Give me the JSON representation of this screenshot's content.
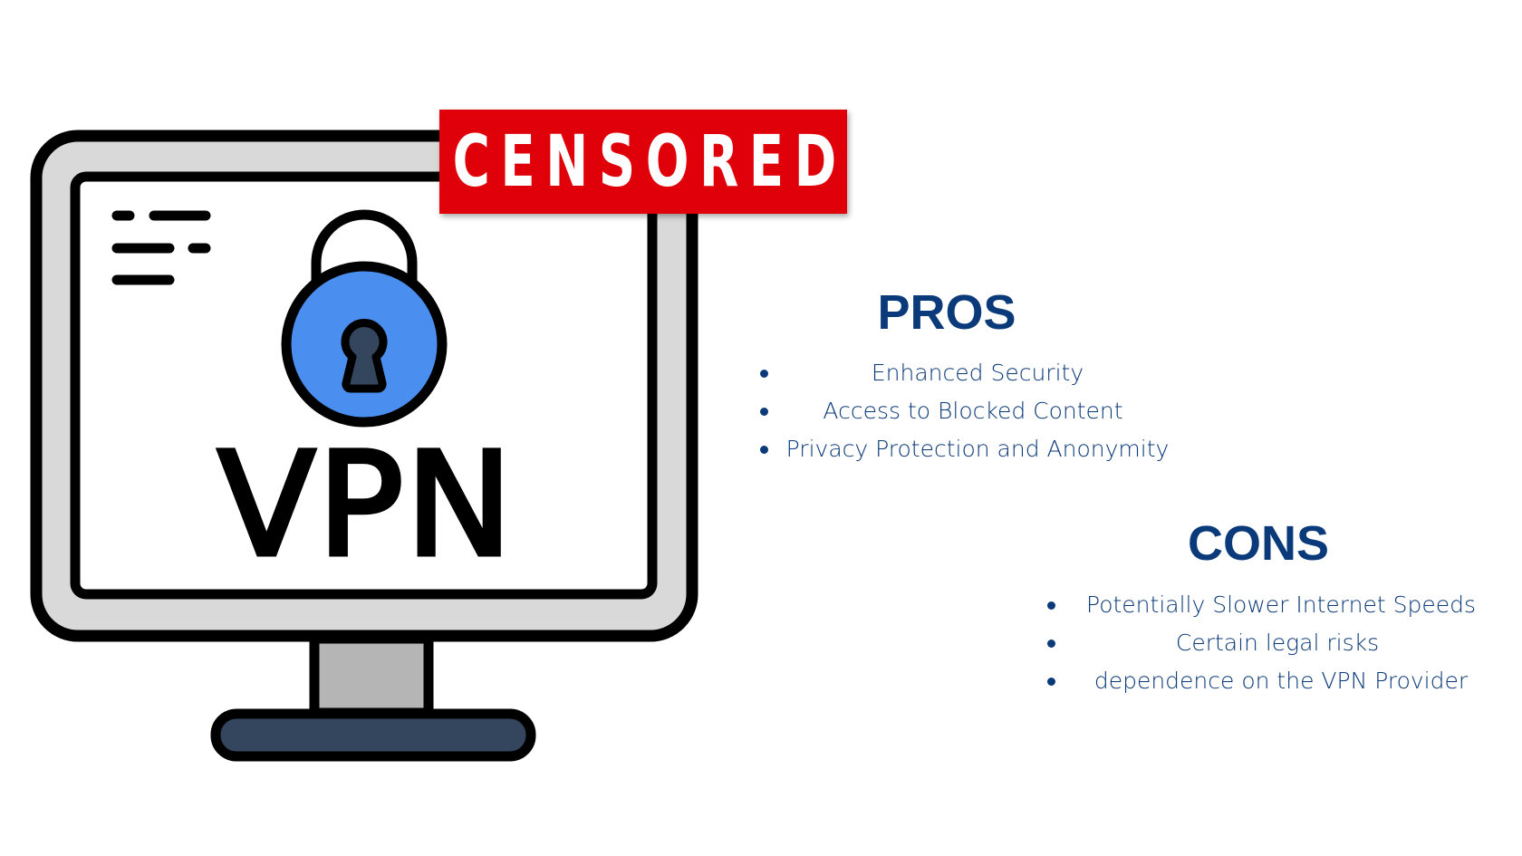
{
  "illustration": {
    "screen_label": "VPN",
    "banner_text": "CENSORED",
    "colors": {
      "banner": "#e00009",
      "lock_body": "#4a8ff0",
      "keyhole": "#34455e",
      "monitor_bezel": "#d9d9d9",
      "stand": "#b5b5b5",
      "base": "#34455e",
      "outline": "#000000"
    }
  },
  "pros": {
    "title": "PROS",
    "items": [
      "Enhanced Security",
      "Access to Blocked Content",
      "Privacy Protection and Anonymity"
    ]
  },
  "cons": {
    "title": "CONS",
    "items": [
      "Potentially Slower Internet Speeds",
      "Certain legal risks",
      "dependence on the VPN Provider"
    ]
  },
  "text_color": "#0b3a7a"
}
